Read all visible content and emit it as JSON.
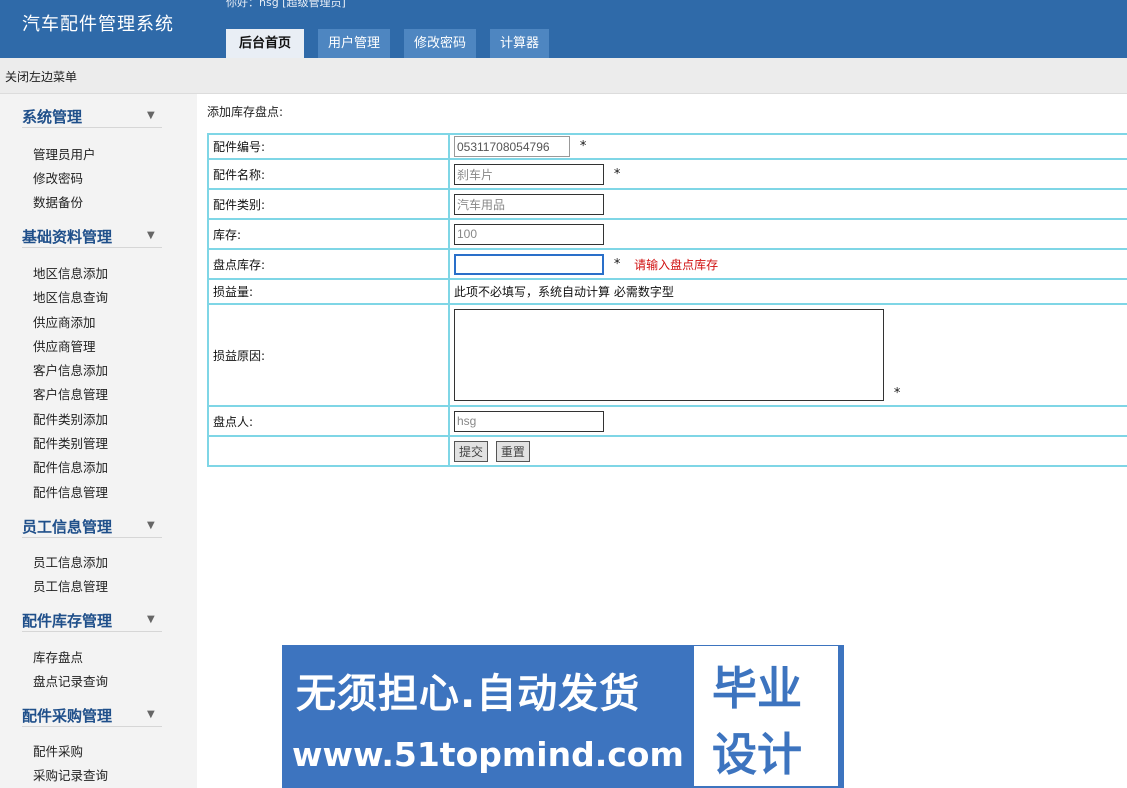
{
  "header": {
    "app_title": "汽车配件管理系统",
    "greeting": "你好：hsg [超级管理员]",
    "tabs": [
      "后台首页",
      "用户管理",
      "修改密码",
      "计算器"
    ]
  },
  "subbar": {
    "close_menu": "关闭左边菜单"
  },
  "sidebar": {
    "groups": [
      {
        "title": "系统管理",
        "items": [
          "管理员用户",
          "修改密码",
          "数据备份"
        ]
      },
      {
        "title": "基础资料管理",
        "items": [
          "地区信息添加",
          "地区信息查询",
          "供应商添加",
          "供应商管理",
          "客户信息添加",
          "客户信息管理",
          "配件类别添加",
          "配件类别管理",
          "配件信息添加",
          "配件信息管理"
        ]
      },
      {
        "title": "员工信息管理",
        "items": [
          "员工信息添加",
          "员工信息管理"
        ]
      },
      {
        "title": "配件库存管理",
        "items": [
          "库存盘点",
          "盘点记录查询"
        ]
      },
      {
        "title": "配件采购管理",
        "items": [
          "配件采购",
          "采购记录查询"
        ]
      }
    ],
    "arrow": "▼"
  },
  "main": {
    "page_title": "添加库存盘点:",
    "form": {
      "part_code_label": "配件编号:",
      "part_code_value": "05311708054796",
      "part_name_label": "配件名称:",
      "part_name_value": "刹车片",
      "part_category_label": "配件类别:",
      "part_category_value": "汽车用品",
      "stock_label": "库存:",
      "stock_value": "100",
      "count_stock_label": "盘点库存:",
      "count_stock_value": "",
      "count_stock_error": "请输入盘点库存",
      "gain_loss_label": "损益量:",
      "gain_loss_note": "此项不必填写，系统自动计算 必需数字型",
      "reason_label": "损益原因:",
      "reason_value": "",
      "counter_label": "盘点人:",
      "counter_value": "hsg",
      "required_mark": "*",
      "submit_label": "提交",
      "reset_label": "重置"
    }
  },
  "banner": {
    "line1": "无须担心.自动发货",
    "line2": "www.51topmind.com",
    "right_line1": "毕业",
    "right_line2": "设计"
  }
}
